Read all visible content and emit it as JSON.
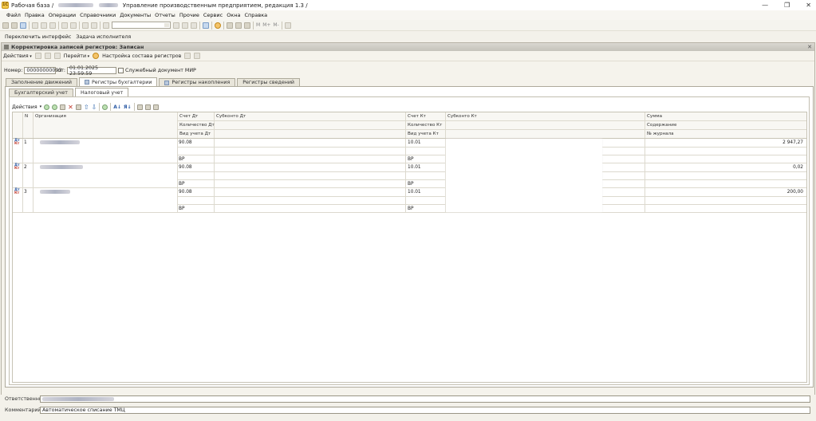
{
  "window": {
    "title_prefix": "Рабочая база /",
    "title_suffix": "Управление производственным предприятием, редакция 1.3 /",
    "icon_label": "1С"
  },
  "menu": [
    "Файл",
    "Правка",
    "Операции",
    "Справочники",
    "Документы",
    "Отчеты",
    "Прочие",
    "Сервис",
    "Окна",
    "Справка"
  ],
  "subbar": {
    "switch_interface": "Переключить интерфейс",
    "executor_task": "Задача исполнителя"
  },
  "document": {
    "title": "Корректировка записей регистров: Записан",
    "toolbar": {
      "actions": "Действия",
      "go": "Перейти",
      "register_setup": "Настройка состава регистров"
    },
    "number_label": "Номер:",
    "number_value": "00000000093",
    "date_label": "от:",
    "date_value": "01.01.2025 23:59:59",
    "service_doc_label": "Служебный документ МИР",
    "tabs": [
      "Заполнение движений",
      "Регистры бухгалтерии",
      "Регистры накопления",
      "Регистры сведений"
    ],
    "subtabs": [
      "Бухгалтерский учет",
      "Налоговый учет"
    ],
    "grid_actions": "Действия",
    "columns": {
      "n": "N",
      "org": "Организация",
      "schet_dt": "Счет Дт",
      "kol_dt": "Количество Дт",
      "vid_dt": "Вид учета Дт",
      "subkonto_dt": "Субконто Дт",
      "schet_kt": "Счет Кт",
      "kol_kt": "Количество Кт",
      "vid_kt": "Вид учета Кт",
      "subkonto_kt": "Субконто Кт",
      "summa": "Сумма",
      "soderzhanie": "Содержание",
      "journal": "№ журнала"
    },
    "rows": [
      {
        "n": "1",
        "schet_dt": "90.08",
        "vid_dt": "ВР",
        "schet_kt": "10.01",
        "vid_kt": "ВР",
        "summa": "2 947,27"
      },
      {
        "n": "2",
        "schet_dt": "90.08",
        "vid_dt": "ВР",
        "schet_kt": "10.01",
        "vid_kt": "ВР",
        "summa": "0,02"
      },
      {
        "n": "3",
        "schet_dt": "90.08",
        "vid_dt": "ВР",
        "schet_kt": "10.01",
        "vid_kt": "ВР",
        "summa": "200,00"
      }
    ],
    "row_icon": {
      "dt": "Дт",
      "kt": "Кт"
    }
  },
  "footer": {
    "responsible_label": "Ответственный:",
    "comment_label": "Комментарий:",
    "comment_value": "Автоматическое списание ТМЦ"
  },
  "icons": [
    "app-icon",
    "minimize-icon",
    "restore-icon",
    "close-icon"
  ]
}
